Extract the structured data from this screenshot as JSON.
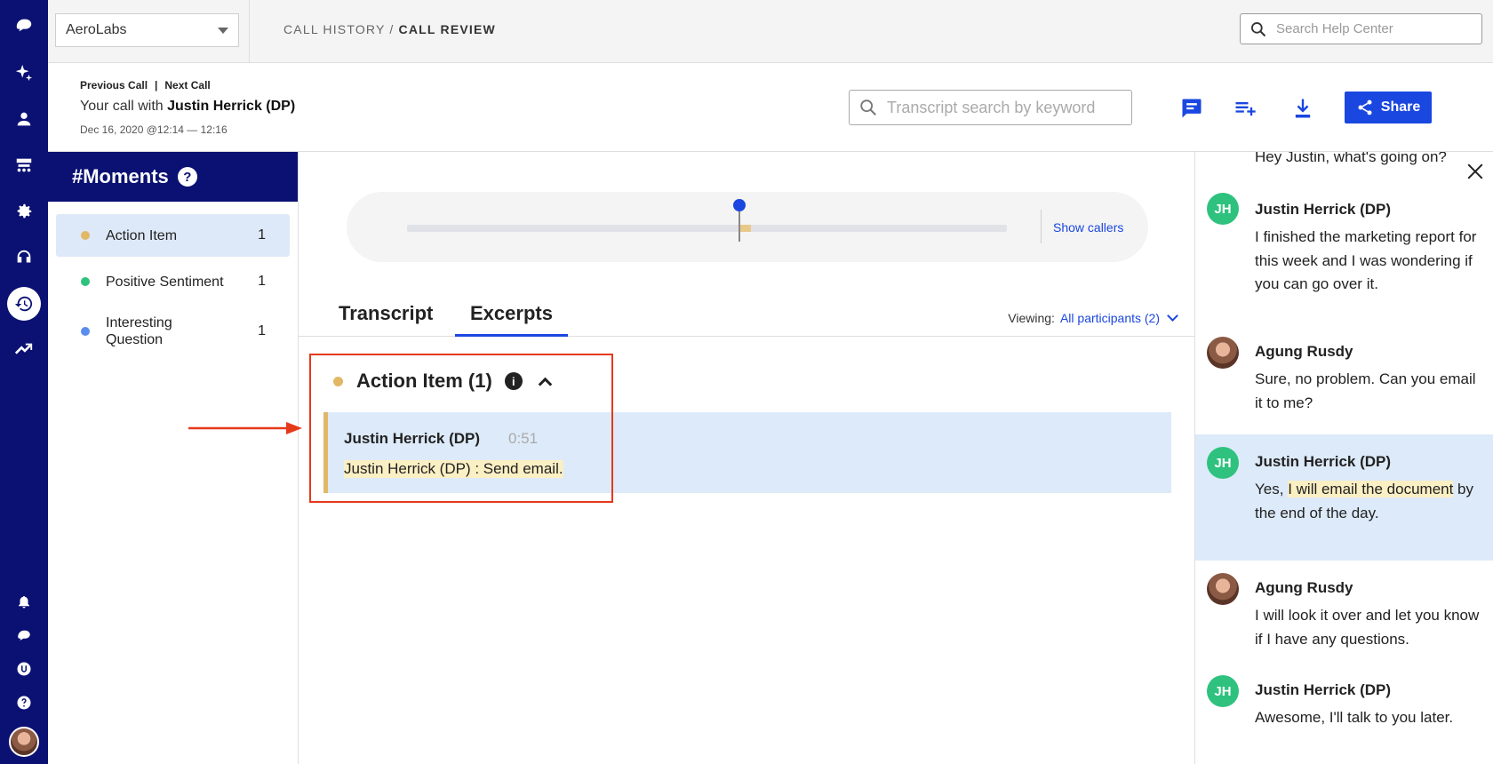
{
  "org_selector": {
    "value": "AeroLabs"
  },
  "breadcrumb": {
    "parent": "CALL HISTORY",
    "separator": " / ",
    "current": "CALL REVIEW"
  },
  "help_search": {
    "placeholder": "Search Help Center"
  },
  "call": {
    "previous_label": "Previous Call",
    "next_label": "Next Call",
    "title_prefix": "Your call with ",
    "title_name": "Justin Herrick (DP)",
    "date": "Dec 16, 2020 @12:14 — 12:16"
  },
  "transcript_search": {
    "placeholder": "Transcript search by keyword"
  },
  "share_label": "Share",
  "moments": {
    "title": "#Moments",
    "help_badge": "?",
    "items": [
      {
        "label": "Action Item",
        "count": "1",
        "color": "#e2b866"
      },
      {
        "label": "Positive Sentiment",
        "count": "1",
        "color": "#2ec27e"
      },
      {
        "label": "Interesting Question",
        "count": "1",
        "color": "#5b8def"
      }
    ]
  },
  "timeline": {
    "show_callers": "Show callers",
    "position_fraction": 0.52
  },
  "tabs": [
    {
      "label": "Transcript"
    },
    {
      "label": "Excerpts"
    }
  ],
  "viewing": {
    "label": "Viewing:",
    "value": "All participants (2)"
  },
  "action_item": {
    "title": "Action Item (1)",
    "info": "i",
    "excerpt": {
      "speaker": "Justin Herrick (DP)",
      "time": "0:51",
      "text": "Justin Herrick (DP) : Send email."
    }
  },
  "transcript": {
    "partial_top": "Hey Justin, what's going on?",
    "messages": [
      {
        "initials": "JH",
        "name": "Justin Herrick (DP)",
        "text": "I finished the marketing report for this week and I was wondering if you can go over it."
      },
      {
        "initials": "",
        "name": "Agung Rusdy",
        "text": "Sure, no problem. Can you email it to me?"
      },
      {
        "initials": "JH",
        "name": "Justin Herrick (DP)",
        "text_before": "Yes, ",
        "text_highlight": "I will email the document",
        "text_after": " by the end of the day."
      },
      {
        "initials": "",
        "name": "Agung Rusdy",
        "text": "I will look it over and let you know if I have any questions."
      },
      {
        "initials": "JH",
        "name": "Justin Herrick (DP)",
        "text": "Awesome, I'll talk to you later."
      }
    ]
  },
  "colors": {
    "nav_bg": "#0a1172",
    "accent": "#1a47e0",
    "action_item": "#e2b866",
    "highlight": "#fbefc4",
    "annotation_red": "#e6391a"
  }
}
